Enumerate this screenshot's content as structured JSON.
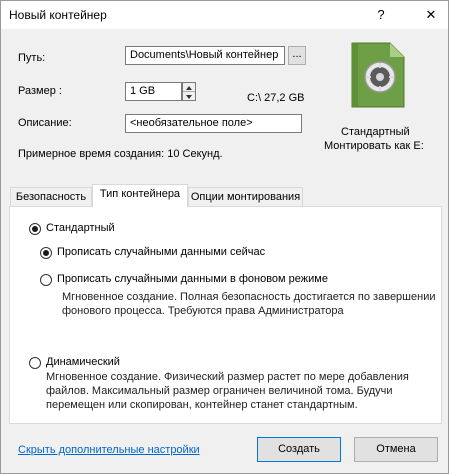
{
  "window": {
    "title": "Новый контейнер",
    "help_glyph": "?",
    "close_glyph": "✕"
  },
  "form": {
    "path_label": "Путь:",
    "path_value": "Documents\\Новый контейнер",
    "browse_label": "...",
    "size_label": "Размер :",
    "size_value": "1 GB",
    "free_space": "C:\\ 27,2 GB",
    "desc_label": "Описание:",
    "desc_value": "<необязательное поле>",
    "creation_time": "Примерное время создания: 10 Секунд."
  },
  "summary": {
    "type_text": "Стандартный",
    "mount_text": "Монтировать как E:"
  },
  "tabs": [
    {
      "label": "Безопасность"
    },
    {
      "label": "Тип контейнера"
    },
    {
      "label": "Опции монтирования"
    }
  ],
  "options": {
    "standard_label": "Стандартный",
    "write_now_label": "Прописать случайными данными сейчас",
    "write_bg_label": "Прописать случайными данными в фоновом режиме",
    "write_bg_desc_1": "Мгновенное создание. Полная безопасность достигается по завершении",
    "write_bg_desc_2": "фонового процесса. Требуются права Администратора",
    "dynamic_label": "Динамический",
    "dynamic_desc_1": "Мгновенное создание. Физический размер растет по мере добавления",
    "dynamic_desc_2": "файлов. Максимальный размер ограничен величиной тома. Будучи",
    "dynamic_desc_3": "перемещен или скопирован, контейнер станет стандартным."
  },
  "footer": {
    "advanced_link": "Скрыть дополнительные настройки",
    "create_label": "Создать",
    "cancel_label": "Отмена"
  },
  "icon": "safe-container-icon"
}
